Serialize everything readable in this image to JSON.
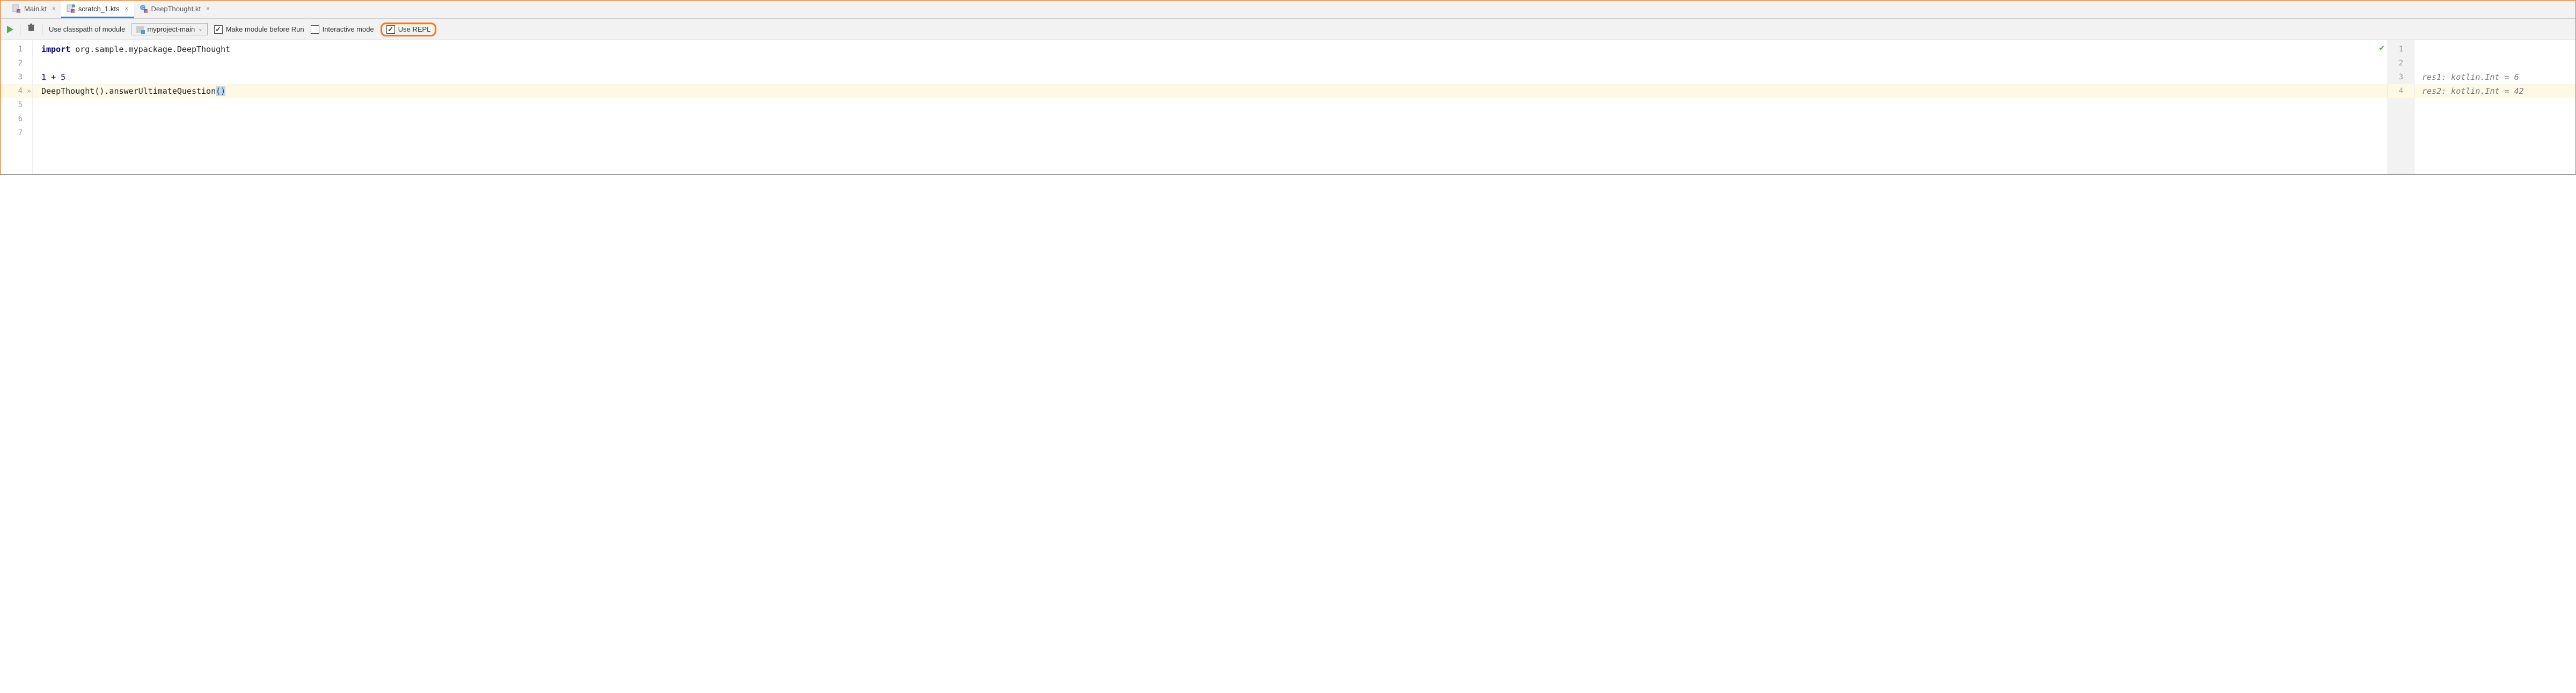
{
  "tabs": [
    {
      "label": "Main.kt",
      "active": false,
      "kind": "kt"
    },
    {
      "label": "scratch_1.kts",
      "active": true,
      "kind": "scratch"
    },
    {
      "label": "DeepThought.kt",
      "active": false,
      "kind": "class"
    }
  ],
  "toolbar": {
    "classpath_label": "Use classpath of module",
    "module_name": "myproject-main",
    "make_module_label": "Make module before Run",
    "make_module_checked": true,
    "interactive_label": "Interactive mode",
    "interactive_checked": false,
    "use_repl_label": "Use REPL",
    "use_repl_checked": true
  },
  "editor": {
    "lines": [
      {
        "n": 1,
        "segments": [
          {
            "t": "import ",
            "c": "kw"
          },
          {
            "t": "org.sample.mypackage.DeepThought",
            "c": "plain"
          }
        ]
      },
      {
        "n": 2,
        "segments": []
      },
      {
        "n": 3,
        "segments": [
          {
            "t": "1",
            "c": "num"
          },
          {
            "t": " + ",
            "c": "plain"
          },
          {
            "t": "5",
            "c": "num"
          }
        ]
      },
      {
        "n": 4,
        "current": true,
        "run_marker": "»",
        "segments": [
          {
            "t": "DeepThought().answerUltimateQuestion",
            "c": "plain"
          },
          {
            "t": "()",
            "c": "bracket-hl"
          }
        ]
      },
      {
        "n": 5,
        "segments": []
      },
      {
        "n": 6,
        "segments": []
      },
      {
        "n": 7,
        "segments": []
      }
    ],
    "status": "ok"
  },
  "results": {
    "lines": [
      {
        "n": 1,
        "text": ""
      },
      {
        "n": 2,
        "text": ""
      },
      {
        "n": 3,
        "text": "res1: kotlin.Int = 6"
      },
      {
        "n": 4,
        "current": true,
        "text": "res2: kotlin.Int = 42"
      }
    ]
  }
}
